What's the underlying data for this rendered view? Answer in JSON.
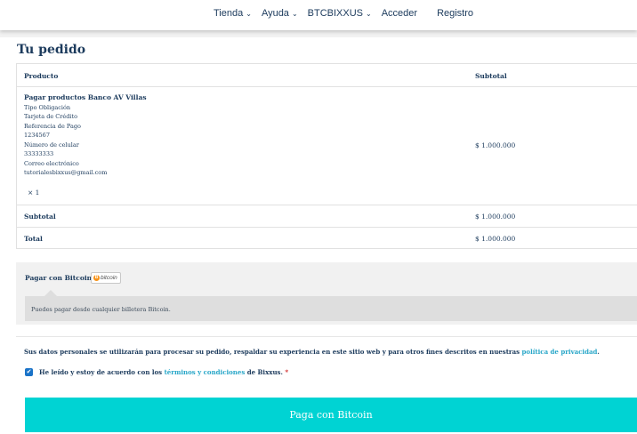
{
  "nav": {
    "items": [
      {
        "label": "Tienda",
        "has_dropdown": true
      },
      {
        "label": "Ayuda",
        "has_dropdown": true
      },
      {
        "label": "BTCBIXXUS",
        "has_dropdown": true
      },
      {
        "label": "Acceder",
        "has_dropdown": false
      },
      {
        "label": "Registro",
        "has_dropdown": false
      }
    ],
    "chevron_icon": "chevron-down-icon"
  },
  "page": {
    "title": "Tu pedido"
  },
  "order": {
    "col_product": "Producto",
    "col_subtotal": "Subtotal",
    "product": {
      "name": "Pagar productos Banco AV Villas",
      "lines": [
        "Tipo Obligación",
        "Tarjeta de Crédito",
        "Referencia de Pago",
        "1234567",
        "Número de celular",
        "33333333",
        "Correo electrónico",
        "tutorialesbixxus@gmail.com"
      ],
      "qty": "× 1",
      "price": "$ 1.000.000"
    },
    "subtotal_label": "Subtotal",
    "subtotal_value": "$ 1.000.000",
    "total_label": "Total",
    "total_value": "$ 1.000.000"
  },
  "payment": {
    "method_label": "Pagar con Bitcoin",
    "badge_text": "bitcoin",
    "badge_coin": "B",
    "badge_icon": "bitcoin-logo-icon",
    "description": "Puedes pagar desde cualquier billetera Bitcoin."
  },
  "privacy": {
    "text": "Sus datos personales se utilizarán para procesar su pedido, respaldar su experiencia en este sitio web y para otros fines descritos en nuestras ",
    "link": "política de privacidad",
    "end": "."
  },
  "terms": {
    "checked": true,
    "checkmark": "✔",
    "prefix": "He leído y estoy de acuerdo con los ",
    "link": "términos y condiciones",
    "suffix": " de Bixxus.",
    "required_mark": " *"
  },
  "submit": {
    "label": "Paga con Bitcoin"
  },
  "colors": {
    "accent": "#00d3d3",
    "link": "#27a6c8",
    "text": "#1b3a5c"
  }
}
